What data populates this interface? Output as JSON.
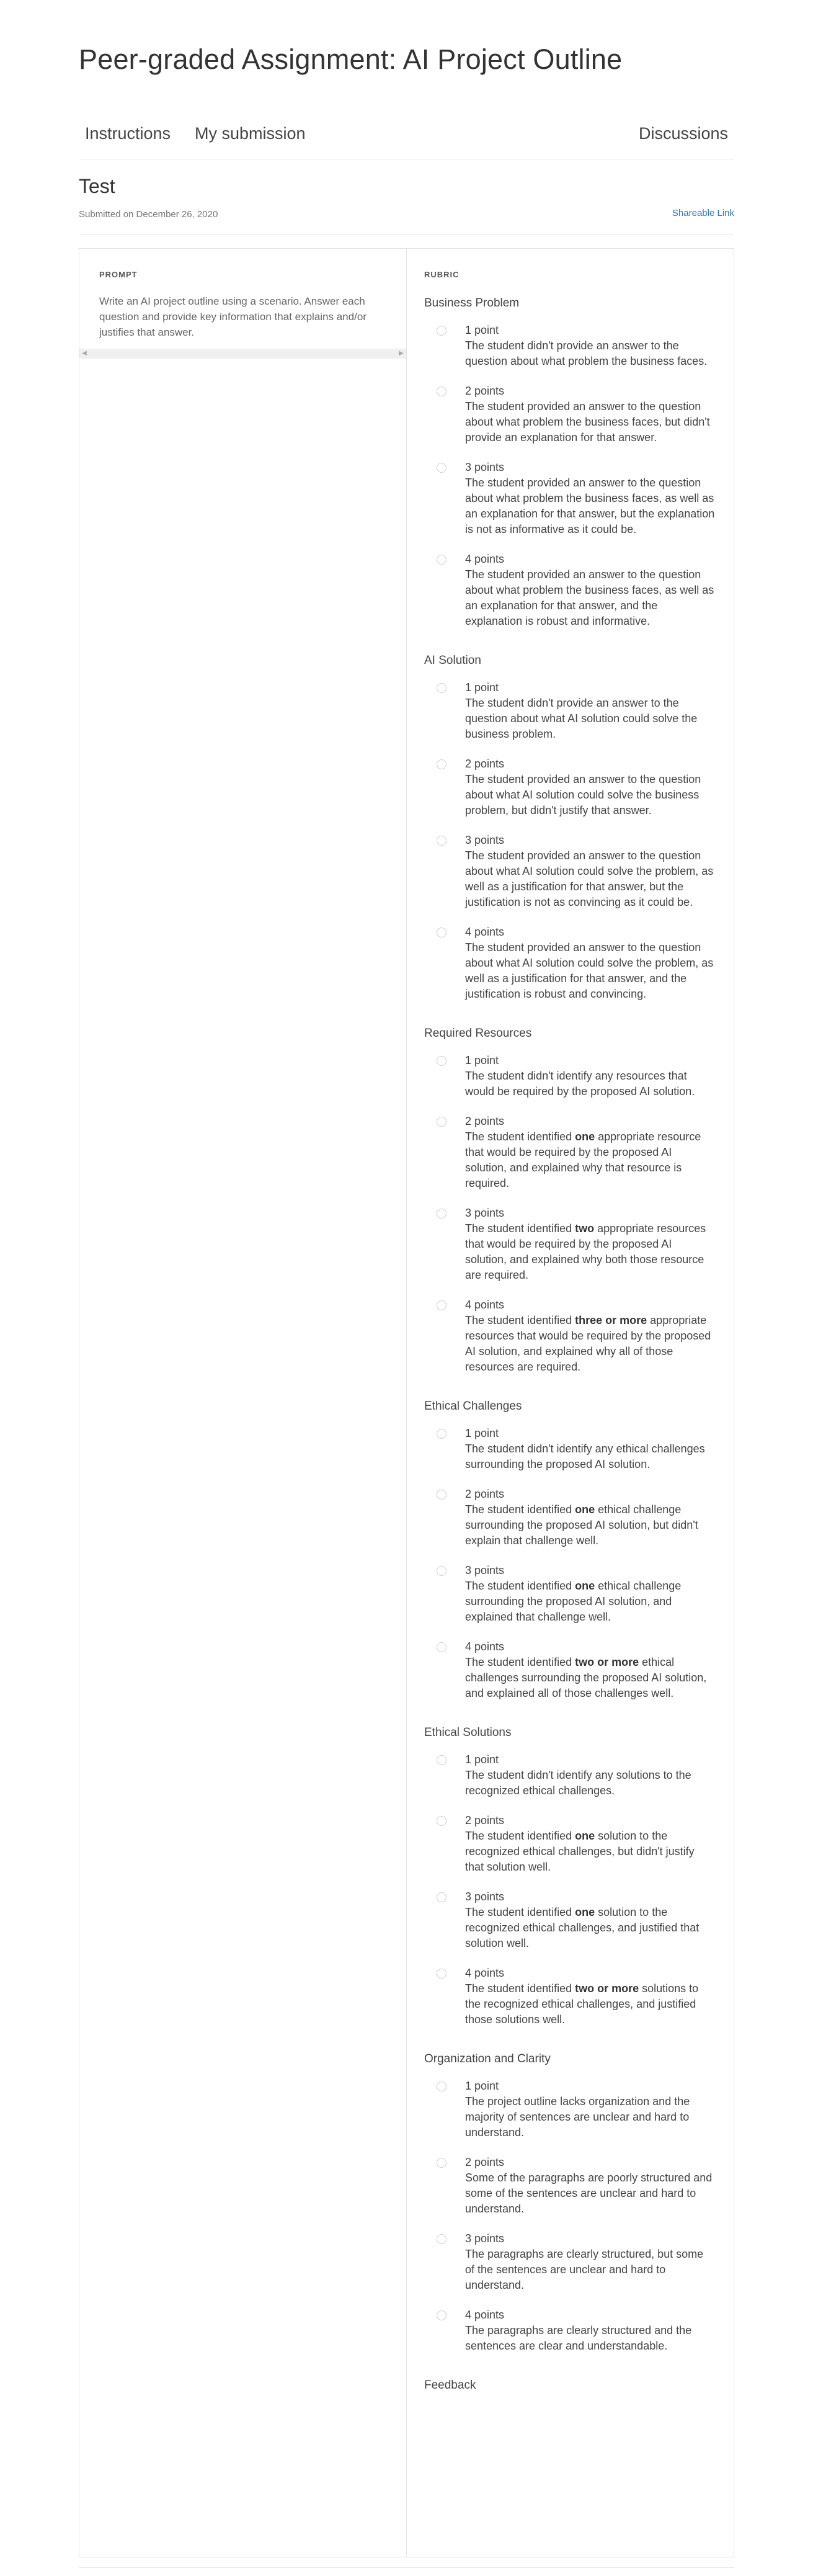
{
  "page_title": "Peer-graded Assignment: AI Project Outline",
  "tabs": {
    "instructions": "Instructions",
    "my_submission": "My submission",
    "discussions": "Discussions"
  },
  "submission": {
    "title": "Test",
    "submitted_on": "Submitted on December 26, 2020",
    "shareable_link": "Shareable Link"
  },
  "prompt": {
    "heading": "PROMPT",
    "text": "Write an AI project outline using a scenario. Answer each question and provide key information that explains and/or justifies that answer."
  },
  "rubric": {
    "heading": "RUBRIC",
    "criteria": [
      {
        "title": "Business Problem",
        "options": [
          {
            "points": "1 point",
            "parts": [
              "The student didn't provide an answer to the question about what problem the business faces."
            ]
          },
          {
            "points": "2 points",
            "parts": [
              "The student provided an answer to the question about what problem the business faces, but didn't provide an explanation for that answer."
            ]
          },
          {
            "points": "3 points",
            "parts": [
              "The student provided an answer to the question about what problem the business faces, as well as an explanation for that answer, but the explanation is not as informative as it could be."
            ]
          },
          {
            "points": "4 points",
            "parts": [
              "The student provided an answer to the question about what problem the business faces, as well as an explanation for that answer, and the explanation is robust and informative."
            ]
          }
        ]
      },
      {
        "title": "AI Solution",
        "options": [
          {
            "points": "1 point",
            "parts": [
              "The student didn't provide an answer to the question about what AI solution could solve the business problem."
            ]
          },
          {
            "points": "2 points",
            "parts": [
              "The student provided an answer to the question about what AI solution could solve the business problem, but didn't justify that answer."
            ]
          },
          {
            "points": "3 points",
            "parts": [
              "The student provided an answer to the question about what AI solution could solve the problem, as well as a justification for that answer, but the justification is not as convincing as it could be."
            ]
          },
          {
            "points": "4 points",
            "parts": [
              "The student provided an answer to the question about what AI solution could solve the problem, as well as a justification for that answer, and the justification is robust and convincing."
            ]
          }
        ]
      },
      {
        "title": "Required Resources",
        "options": [
          {
            "points": "1 point",
            "parts": [
              "The student didn't identify any resources that would be required by the proposed AI solution."
            ]
          },
          {
            "points": "2 points",
            "parts": [
              "The student identified ",
              "one",
              " appropriate resource that would be required by the proposed AI solution, and explained why that resource is required."
            ]
          },
          {
            "points": "3 points",
            "parts": [
              "The student identified ",
              "two",
              " appropriate resources that would be required by the proposed AI solution, and explained why both those resource are required."
            ]
          },
          {
            "points": "4 points",
            "parts": [
              "The student identified ",
              "three or more",
              " appropriate resources that would be required by the proposed AI solution, and explained why all of those resources are required."
            ]
          }
        ]
      },
      {
        "title": "Ethical Challenges",
        "options": [
          {
            "points": "1 point",
            "parts": [
              "The student didn't identify any ethical challenges surrounding the proposed AI solution."
            ]
          },
          {
            "points": "2 points",
            "parts": [
              "The student identified ",
              "one",
              " ethical challenge surrounding the proposed AI solution, but didn't explain that challenge well."
            ]
          },
          {
            "points": "3 points",
            "parts": [
              "The student identified ",
              "one",
              " ethical challenge surrounding the proposed AI solution, and explained that challenge well."
            ]
          },
          {
            "points": "4 points",
            "parts": [
              "The student identified ",
              "two or more",
              " ethical challenges surrounding the proposed AI solution, and explained all of those challenges well."
            ]
          }
        ]
      },
      {
        "title": "Ethical Solutions",
        "options": [
          {
            "points": "1 point",
            "parts": [
              "The student didn't identify any solutions to the recognized ethical challenges."
            ]
          },
          {
            "points": "2 points",
            "parts": [
              "The student identified ",
              "one",
              " solution to the recognized ethical challenges, but didn't justify that solution well."
            ]
          },
          {
            "points": "3 points",
            "parts": [
              "The student identified ",
              "one",
              " solution to the recognized ethical challenges, and justified that solution well."
            ]
          },
          {
            "points": "4 points",
            "parts": [
              "The student identified ",
              "two or more",
              " solutions to the recognized ethical challenges, and justified those solutions well."
            ]
          }
        ]
      },
      {
        "title": "Organization and Clarity",
        "options": [
          {
            "points": "1 point",
            "parts": [
              "The project outline lacks organization and the majority of sentences are unclear and hard to understand."
            ]
          },
          {
            "points": "2 points",
            "parts": [
              "Some of the paragraphs are poorly structured and some of the sentences are unclear and hard to understand."
            ]
          },
          {
            "points": "3 points",
            "parts": [
              "The paragraphs are clearly structured, but some of the sentences are unclear and hard to understand."
            ]
          },
          {
            "points": "4 points",
            "parts": [
              "The paragraphs are clearly structured and the sentences are clear and understandable."
            ]
          }
        ]
      }
    ],
    "feedback_label": "Feedback"
  }
}
